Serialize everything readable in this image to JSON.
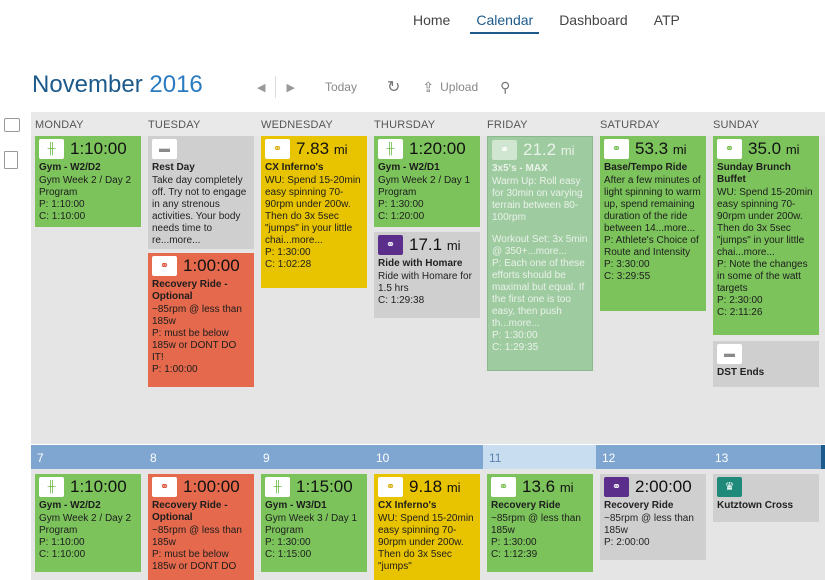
{
  "nav": {
    "items": [
      "Home",
      "Calendar",
      "Dashboard",
      "ATP"
    ]
  },
  "header": {
    "month": "November",
    "year": "2016",
    "today": "Today",
    "upload": "Upload"
  },
  "days": [
    "MONDAY",
    "TUESDAY",
    "WEDNESDAY",
    "THURSDAY",
    "FRIDAY",
    "SATURDAY",
    "SUNDAY"
  ],
  "week2_dates": [
    "7",
    "8",
    "9",
    "10",
    "11",
    "12",
    "13"
  ],
  "w1": {
    "mon": {
      "val": "1:10:00",
      "title": "Gym - W2/D2",
      "desc": "Gym Week 2 / Day 2 Program",
      "p": "P: 1:10:00",
      "c": "C: 1:10:00"
    },
    "tue1": {
      "title": "Rest Day",
      "desc": "Take day completely off. Try not to engage in any strenous activities. Your body needs time to re...more..."
    },
    "tue2": {
      "val": "1:00:00",
      "title": "Recovery Ride - Optional",
      "desc": "~85rpm @ less than 185w",
      "p": "P: must be below 185w or DONT DO IT!",
      "c": "P: 1:00:00"
    },
    "wed": {
      "val": "7.83",
      "unit": "mi",
      "title": "CX Inferno's",
      "desc": "WU: Spend 15-20min easy spinning 70-90rpm under 200w. Then do 3x 5sec \"jumps\" in your little chai...more...",
      "p": "P: 1:30:00",
      "c": "C: 1:02:28"
    },
    "thu1": {
      "val": "1:20:00",
      "title": "Gym - W2/D1",
      "desc": "Gym Week 2 / Day 1 Program",
      "p": "P: 1:30:00",
      "c": "C: 1:20:00"
    },
    "thu2": {
      "val": "17.1",
      "unit": "mi",
      "title": "Ride with Homare",
      "desc": "Ride with Homare for 1.5 hrs",
      "c": "C: 1:29:38"
    },
    "fri": {
      "val": "21.2",
      "unit": "mi",
      "title": "3x5's - MAX",
      "desc": "Warm Up: Roll easy for 30min on varying terrain between 80-100rpm",
      "desc2": "Workout Set: 3x 5min @ 350+...more...",
      "p": "P: Each one of these efforts should be maximal but equal. If the first one is too easy, then push th...more...",
      "p2": "P: 1:30:00",
      "c": "C: 1:29:35"
    },
    "sat": {
      "val": "53.3",
      "unit": "mi",
      "title": "Base/Tempo Ride",
      "desc": "After a few minutes of light spinning to warm up, spend remaining duration of the ride between 14...more...",
      "p": "P: Athlete's Choice of Route and Intensity",
      "p2": "P: 3:30:00",
      "c": "C: 3:29:55"
    },
    "sun1": {
      "val": "35.0",
      "unit": "mi",
      "title": "Sunday Brunch Buffet",
      "desc": "WU: Spend 15-20min easy spinning 70-90rpm under 200w. Then do 3x 5sec \"jumps\" in your little chai...more...",
      "p": "P: Note the changes in some of the watt targets",
      "p2": "P: 2:30:00",
      "c": "C: 2:11:26"
    },
    "sun2": {
      "title": "DST Ends"
    }
  },
  "w2": {
    "mon": {
      "val": "1:10:00",
      "title": "Gym - W2/D2",
      "desc": "Gym Week 2 / Day 2 Program",
      "p": "P: 1:10:00",
      "c": "C: 1:10:00"
    },
    "tue": {
      "val": "1:00:00",
      "title": "Recovery Ride - Optional",
      "desc": "~85rpm @ less than 185w",
      "p": "P: must be below 185w or DONT DO"
    },
    "wed": {
      "val": "1:15:00",
      "title": "Gym - W3/D1",
      "desc": "Gym Week 3 / Day 1 Program",
      "p": "P: 1:30:00",
      "c": "C: 1:15:00"
    },
    "thu": {
      "val": "9.18",
      "unit": "mi",
      "title": "CX Inferno's",
      "desc": "WU: Spend 15-20min easy spinning 70-90rpm under 200w. Then do 3x 5sec \"jumps\""
    },
    "fri": {
      "val": "13.6",
      "unit": "mi",
      "title": "Recovery Ride",
      "desc": "~85rpm @ less than 185w",
      "p": "P: 1:30:00",
      "c": "C: 1:12:39"
    },
    "sat": {
      "val": "2:00:00",
      "title": "Recovery Ride",
      "desc": "~85rpm @ less than 185w",
      "p": "P: 2:00:00"
    },
    "sun": {
      "title": "Kutztown Cross"
    }
  }
}
